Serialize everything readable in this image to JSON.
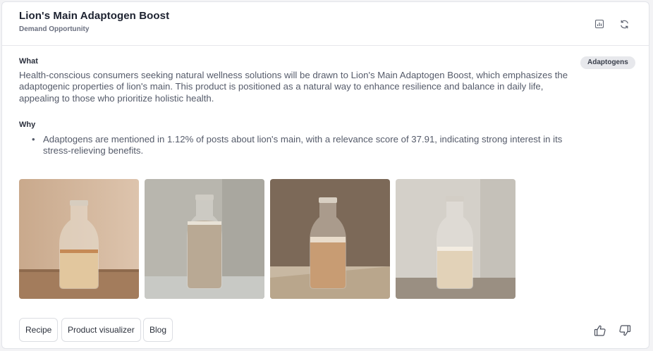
{
  "header": {
    "title": "Lion's Main Adaptogen Boost",
    "subtitle": "Demand Opportunity",
    "icons": [
      "chart-icon",
      "refresh-icon"
    ]
  },
  "what": {
    "label": "What",
    "text": "Health-conscious consumers seeking natural wellness solutions will be drawn to Lion's Main Adaptogen Boost, which emphasizes the adaptogenic properties of lion's main. This product is positioned as a natural way to enhance resilience and balance in daily life, appealing to those who prioritize holistic health."
  },
  "tag": "Adaptogens",
  "why": {
    "label": "Why",
    "items": [
      "Adaptogens are mentioned in 1.12% of posts about lion's main, with a relevance score of 37.91, indicating strong interest in its stress-relieving benefits."
    ]
  },
  "images": [
    {
      "name": "product-image-1",
      "fill_fraction": 0.33
    },
    {
      "name": "product-image-2",
      "fill_fraction": 0.72
    },
    {
      "name": "product-image-3",
      "fill_fraction": 0.55
    },
    {
      "name": "product-image-4",
      "fill_fraction": 0.45
    }
  ],
  "actions": [
    "Recipe",
    "Product visualizer",
    "Blog"
  ],
  "feedback": [
    "thumbs-up-icon",
    "thumbs-down-icon"
  ],
  "colors": {
    "text_primary": "#1d2230",
    "text_secondary": "#555b6a",
    "border": "#dcdee3",
    "tag_bg": "#e7e8ec"
  }
}
